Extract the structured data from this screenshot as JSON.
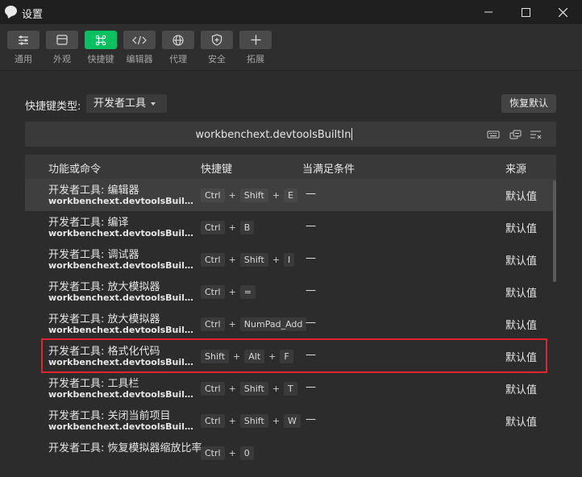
{
  "window": {
    "title": "设置"
  },
  "toolbar": {
    "items": [
      {
        "label": "通用",
        "icon": "sliders-icon",
        "active": false
      },
      {
        "label": "外观",
        "icon": "window-icon",
        "active": false
      },
      {
        "label": "快捷键",
        "icon": "command-icon",
        "active": true
      },
      {
        "label": "编辑器",
        "icon": "code-icon",
        "active": false
      },
      {
        "label": "代理",
        "icon": "globe-icon",
        "active": false
      },
      {
        "label": "安全",
        "icon": "shield-icon",
        "active": false
      },
      {
        "label": "拓展",
        "icon": "plus-icon",
        "active": false
      }
    ]
  },
  "shortcut_type": {
    "label": "快捷键类型:",
    "selected": "开发者工具"
  },
  "reset_button": "恢复默认",
  "search": {
    "value": "workbenchext.devtoolsBuiltIn"
  },
  "table": {
    "headers": {
      "command": "功能或命令",
      "keys": "快捷键",
      "condition": "当满足条件",
      "source": "来源"
    },
    "rows": [
      {
        "name": "开发者工具: 编辑器",
        "command": "workbenchext.devtoolsBuiltIn.t...",
        "keys": [
          "Ctrl",
          "Shift",
          "E"
        ],
        "condition": "—",
        "source": "默认值"
      },
      {
        "name": "开发者工具: 编译",
        "command": "workbenchext.devtoolsBuiltIn.r...",
        "keys": [
          "Ctrl",
          "B"
        ],
        "condition": "—",
        "source": "默认值"
      },
      {
        "name": "开发者工具: 调试器",
        "command": "workbenchext.devtoolsBuiltIn.t...",
        "keys": [
          "Ctrl",
          "Shift",
          "I"
        ],
        "condition": "—",
        "source": "默认值"
      },
      {
        "name": "开发者工具: 放大模拟器",
        "command": "workbenchext.devtoolsBuiltIn.z...",
        "keys": [
          "Ctrl",
          "="
        ],
        "condition": "—",
        "source": "默认值"
      },
      {
        "name": "开发者工具: 放大模拟器",
        "command": "workbenchext.devtoolsBuiltIn.z...",
        "keys": [
          "Ctrl",
          "NumPad_Add"
        ],
        "condition": "—",
        "source": "默认值"
      },
      {
        "name": "开发者工具: 格式化代码",
        "command": "workbenchext.devtoolsBuiltIn.f...",
        "keys": [
          "Shift",
          "Alt",
          "F"
        ],
        "condition": "—",
        "source": "默认值"
      },
      {
        "name": "开发者工具: 工具栏",
        "command": "workbenchext.devtoolsBuiltIn.t...",
        "keys": [
          "Ctrl",
          "Shift",
          "T"
        ],
        "condition": "—",
        "source": "默认值"
      },
      {
        "name": "开发者工具: 关闭当前项目",
        "command": "workbenchext.devtoolsBuiltIn.c...",
        "keys": [
          "Ctrl",
          "Shift",
          "W"
        ],
        "condition": "—",
        "source": "默认值"
      },
      {
        "name": "开发者工具: 恢复模拟器缩放比率",
        "command": "",
        "keys": [
          "Ctrl",
          "0"
        ],
        "condition": "",
        "source": ""
      }
    ]
  },
  "colors": {
    "accent": "#07c160",
    "highlight": "#e0242b"
  }
}
